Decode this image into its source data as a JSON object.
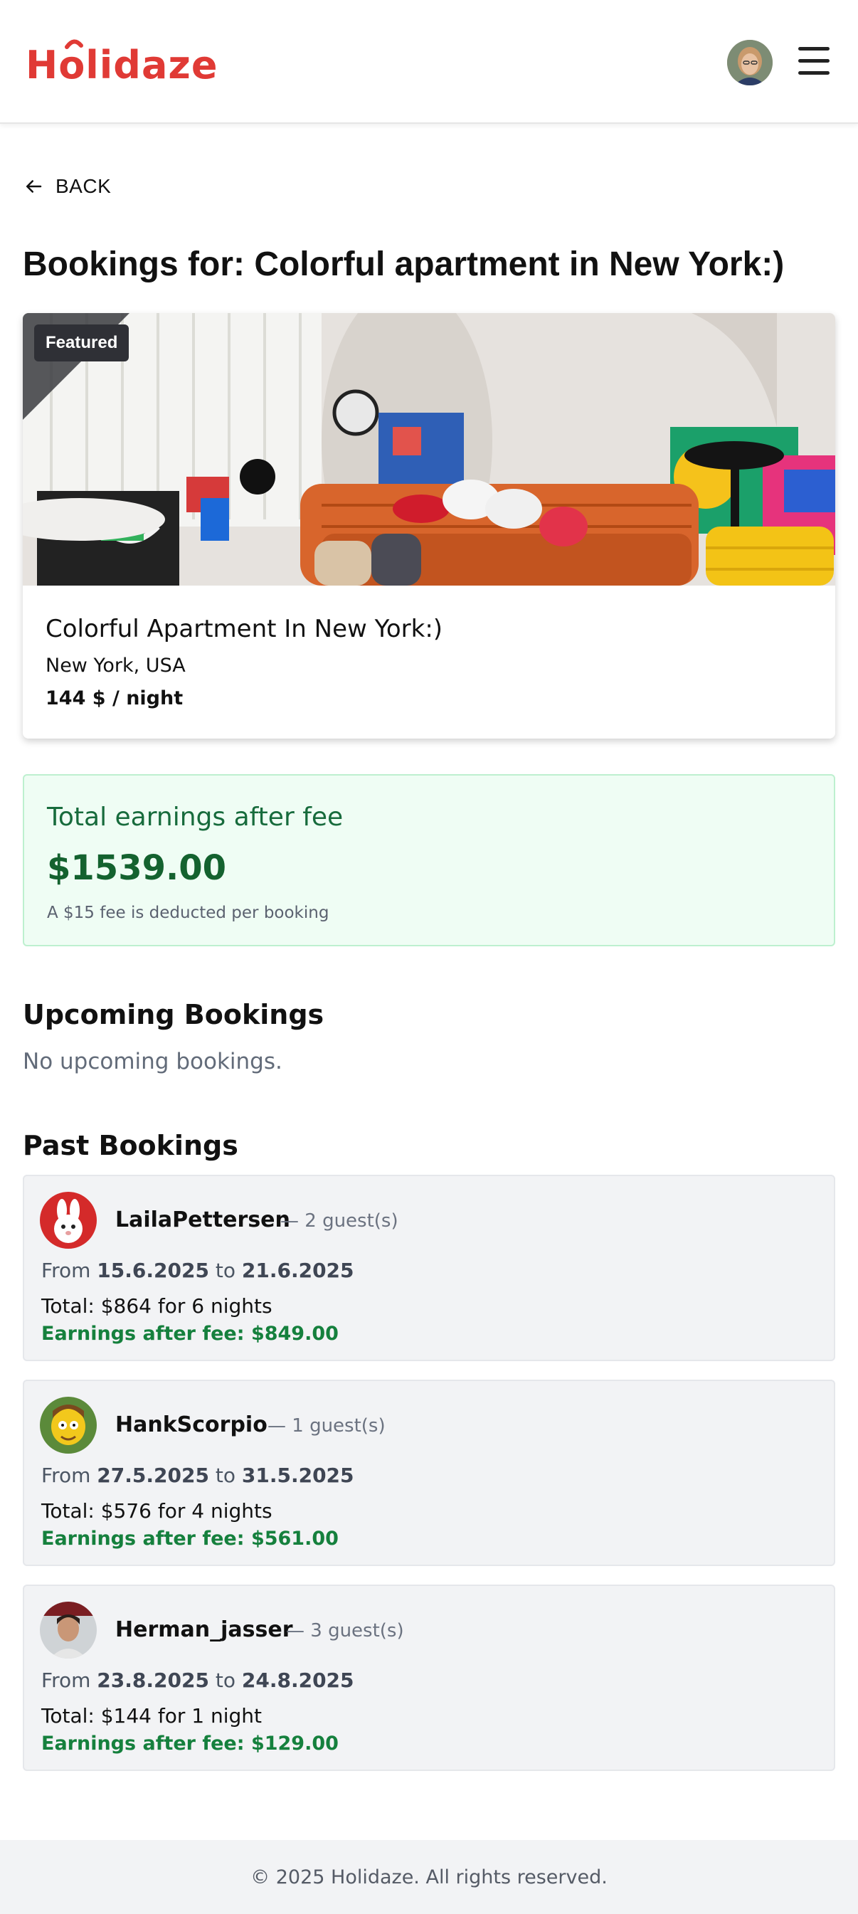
{
  "header": {
    "logo_text": "Holidaze",
    "brand_color": "#e03a35",
    "user_avatar": "user-avatar",
    "menu_icon": "hamburger-menu-icon"
  },
  "back": {
    "label": "BACK",
    "icon": "arrow-left-icon"
  },
  "page_title": "Bookings for: Colorful apartment in New York:)",
  "listing": {
    "badge": "Featured",
    "name": "Colorful Apartment In New York:)",
    "location": "New York, USA",
    "price": "144 $ / night"
  },
  "earnings": {
    "title": "Total earnings after fee",
    "amount": "$1539.00",
    "note": "A $15 fee is deducted per booking",
    "accent_color": "#15803d"
  },
  "upcoming": {
    "heading": "Upcoming Bookings",
    "empty": "No upcoming bookings."
  },
  "past": {
    "heading": "Past Bookings",
    "bookings": [
      {
        "guest": "LailaPettersen",
        "guests": "— 2 guest(s)",
        "from_label": "From",
        "from": "15.6.2025",
        "to_label": "to",
        "to": "21.6.2025",
        "total": "Total: $864 for 6 nights",
        "earnings": "Earnings after fee: $849.00"
      },
      {
        "guest": "HankScorpio",
        "guests": "— 1 guest(s)",
        "from_label": "From",
        "from": "27.5.2025",
        "to_label": "to",
        "to": "31.5.2025",
        "total": "Total: $576 for 4 nights",
        "earnings": "Earnings after fee: $561.00"
      },
      {
        "guest": "Herman_jasser",
        "guests": "— 3 guest(s)",
        "from_label": "From",
        "from": "23.8.2025",
        "to_label": "to",
        "to": "24.8.2025",
        "total": "Total: $144 for 1 night",
        "earnings": "Earnings after fee: $129.00"
      }
    ]
  },
  "footer": {
    "text": "© 2025 Holidaze. All rights reserved."
  }
}
